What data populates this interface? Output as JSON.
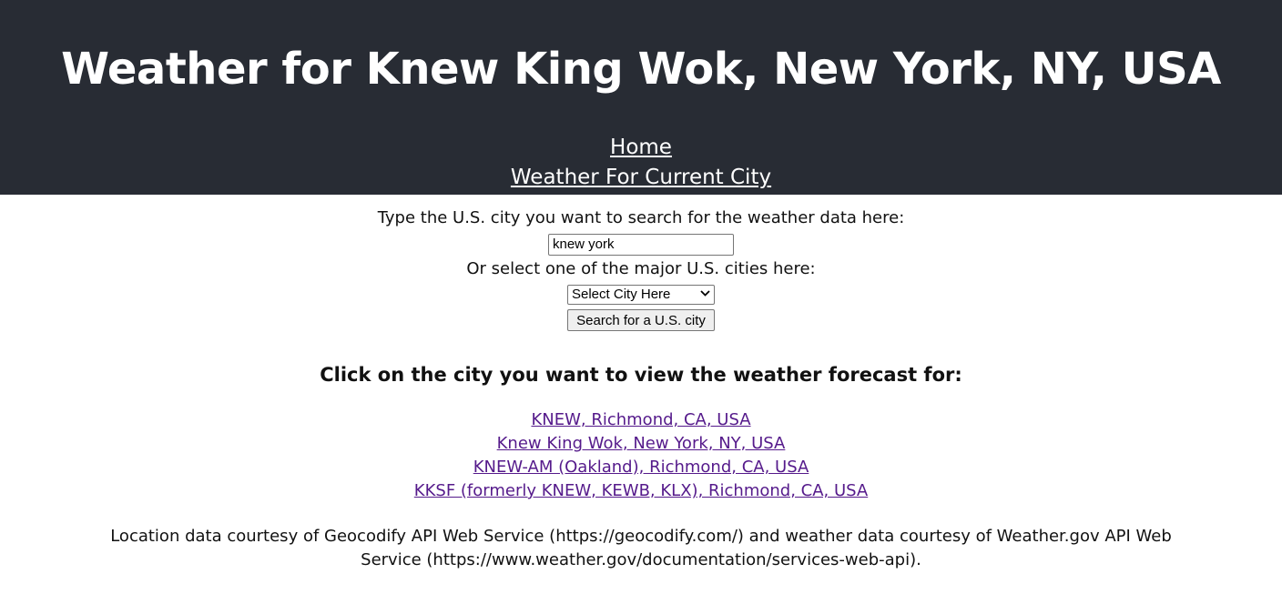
{
  "header": {
    "title": "Weather for Knew King Wok, New York, NY, USA",
    "nav": {
      "home": "Home",
      "current_city": "Weather For Current City"
    }
  },
  "search": {
    "prompt": "Type the U.S. city you want to search for the weather data here:",
    "value": "knew york",
    "select_prompt": "Or select one of the major U.S. cities here:",
    "select_value": "Select City Here",
    "button_label": "Search for a U.S. city"
  },
  "results": {
    "heading": "Click on the city you want to view the weather forecast for:",
    "items": [
      "KNEW, Richmond, CA, USA",
      "Knew King Wok, New York, NY, USA",
      "KNEW-AM (Oakland), Richmond, CA, USA",
      "KKSF (formerly KNEW, KEWB, KLX), Richmond, CA, USA"
    ]
  },
  "footer": {
    "credit": "Location data courtesy of Geocodify API Web Service (https://geocodify.com/) and weather data courtesy of Weather.gov API Web Service (https://www.weather.gov/documentation/services-web-api)."
  },
  "colors": {
    "header_bg": "#282c34",
    "visited_link": "#551a8b"
  },
  "icons": {
    "select_arrow": "chevron-down-icon"
  }
}
